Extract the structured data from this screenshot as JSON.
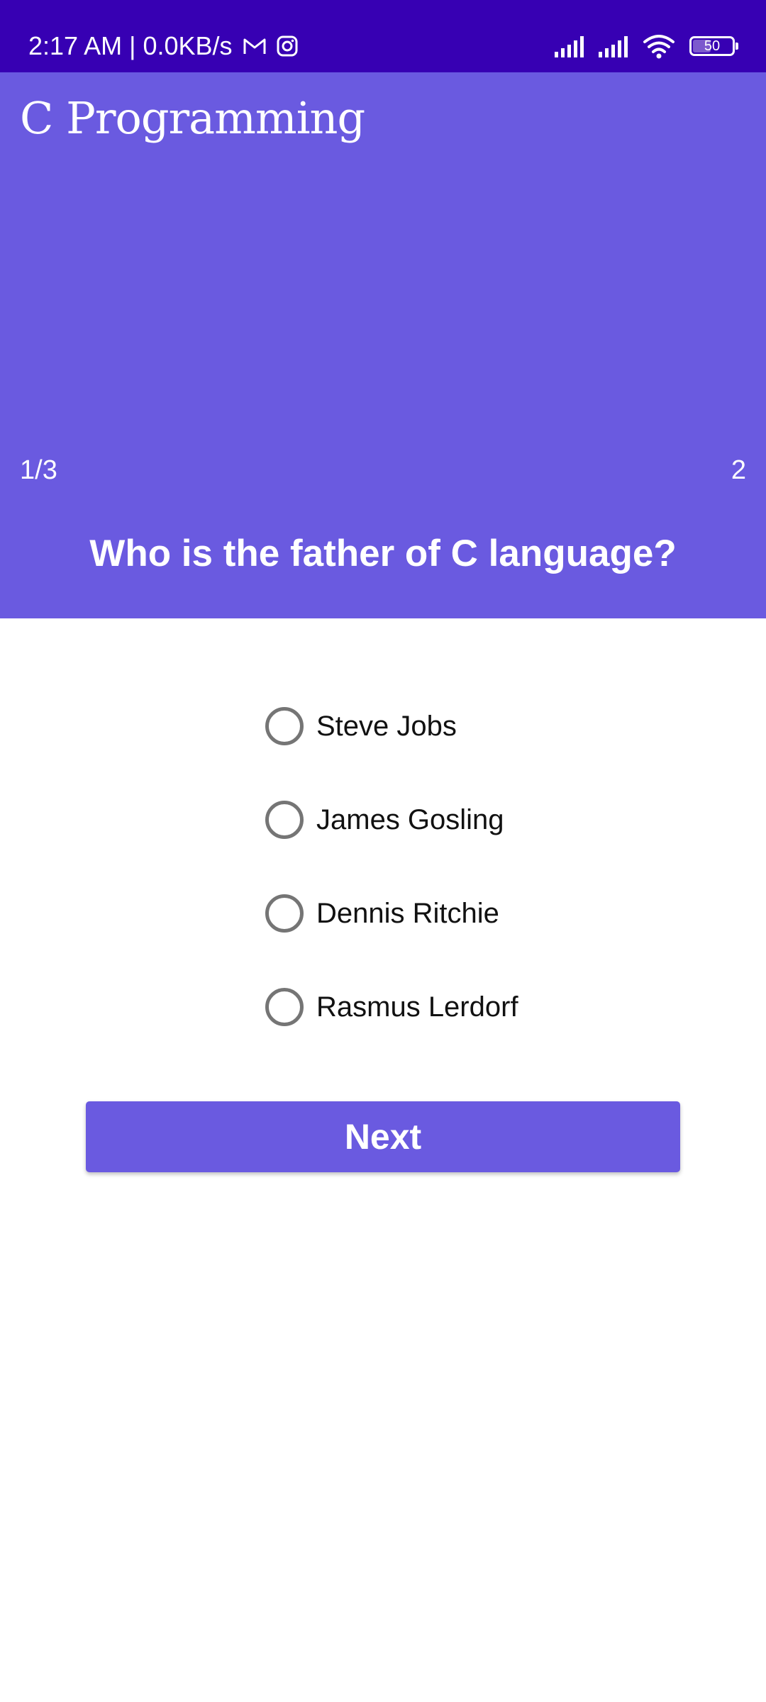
{
  "status_bar": {
    "time_speed": "2:17 AM | 0.0KB/s",
    "icons_left": [
      "gmail-icon",
      "instagram-icon"
    ],
    "icons_right": [
      "signal-icon",
      "signal-icon",
      "wifi-icon"
    ],
    "battery": {
      "level": 50,
      "label": "50"
    }
  },
  "header": {
    "title": "C Programming",
    "progress": "1/3",
    "score": "2",
    "question": "Who is the father of C language?",
    "background_color": "#6a5ae0"
  },
  "options": [
    {
      "label": "Steve Jobs",
      "selected": false
    },
    {
      "label": "James Gosling",
      "selected": false
    },
    {
      "label": "Dennis Ritchie",
      "selected": false
    },
    {
      "label": "Rasmus Lerdorf",
      "selected": false
    }
  ],
  "next_button": {
    "label": "Next"
  },
  "colors": {
    "status_bar": "#3700b3",
    "primary": "#6a5ae0",
    "radio_border": "#757575"
  }
}
